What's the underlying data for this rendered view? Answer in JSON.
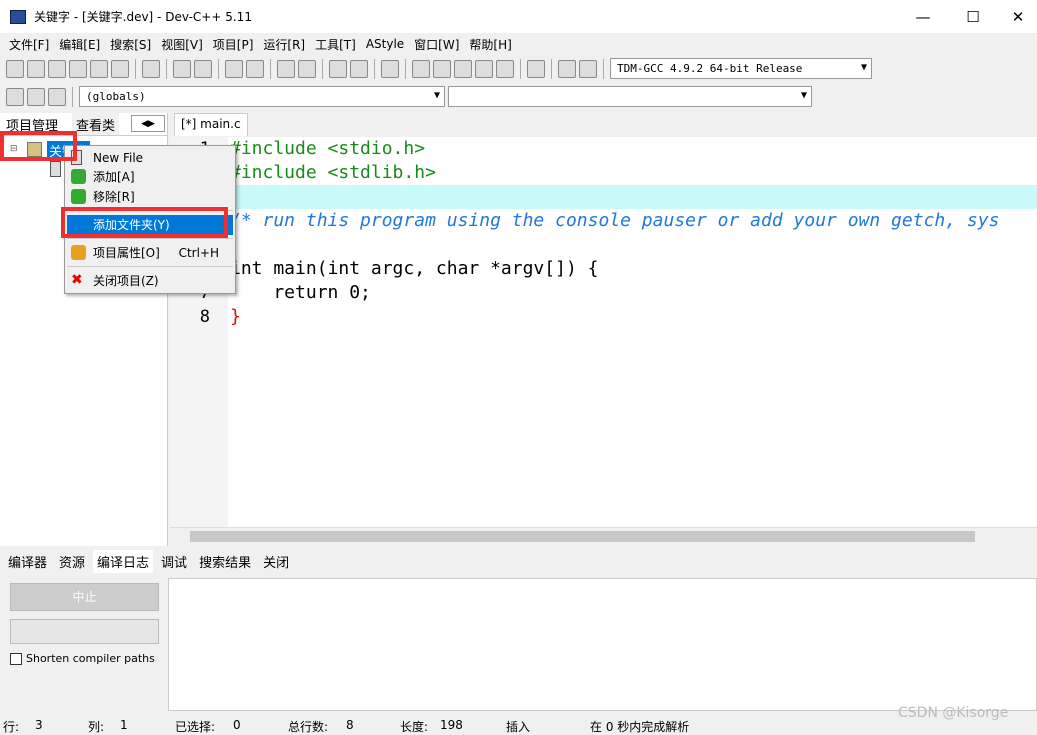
{
  "window": {
    "title": "关键字 - [关键字.dev] - Dev-C++ 5.11",
    "minimize": "—",
    "maximize": "☐",
    "close": "✕"
  },
  "menubar": [
    "文件[F]",
    "编辑[E]",
    "搜索[S]",
    "视图[V]",
    "项目[P]",
    "运行[R]",
    "工具[T]",
    "AStyle",
    "窗口[W]",
    "帮助[H]"
  ],
  "toolbar": {
    "compiler": "TDM-GCC 4.9.2 64-bit Release",
    "scope": "(globals)",
    "member": ""
  },
  "left_panel": {
    "tabs": [
      "项目管理",
      "查看类"
    ],
    "project_name": "关键字"
  },
  "editor": {
    "tab": "[*] main.c",
    "highlight_line": 3,
    "lines": [
      {
        "n": "1",
        "t": "#include <stdio.h>"
      },
      {
        "n": "2",
        "t": "#include <stdlib.h>"
      },
      {
        "n": "3",
        "t": ""
      },
      {
        "n": "4",
        "t": "/* run this program using the console pauser or add your own getch, sys"
      },
      {
        "n": "5",
        "t": ""
      },
      {
        "n": "6",
        "t": "int main(int argc, char *argv[]) {"
      },
      {
        "n": "7",
        "t": "    return 0;"
      },
      {
        "n": "8",
        "t": "}"
      }
    ]
  },
  "context_menu": [
    {
      "label": "New File",
      "icon": "file-icon"
    },
    {
      "label": "添加[A]",
      "icon": "add-icon"
    },
    {
      "label": "移除[R]",
      "icon": "remove-icon"
    },
    {
      "label": "添加文件夹(Y)",
      "icon": "",
      "selected": true
    },
    {
      "label": "项目属性[O]",
      "shortcut": "Ctrl+H",
      "icon": "properties-icon"
    },
    {
      "label": "关闭项目(Z)",
      "icon": "close-red-icon"
    }
  ],
  "bottom": {
    "tabs": [
      "编译器",
      "资源",
      "编译日志",
      "调试",
      "搜索结果",
      "关闭"
    ],
    "abort": "中止",
    "shorten": "Shorten compiler paths"
  },
  "status": {
    "line_label": "行:",
    "line": "3",
    "col_label": "列:",
    "col": "1",
    "sel_label": "已选择:",
    "sel": "0",
    "total_label": "总行数:",
    "total": "8",
    "len_label": "长度:",
    "len": "198",
    "mode": "插入",
    "parse": "在 0 秒内完成解析"
  },
  "watermark": "CSDN @Kisorge",
  "colors": {
    "selection": "#0078d7",
    "highlight": "#c8fafa",
    "annotation": "#f03030"
  }
}
